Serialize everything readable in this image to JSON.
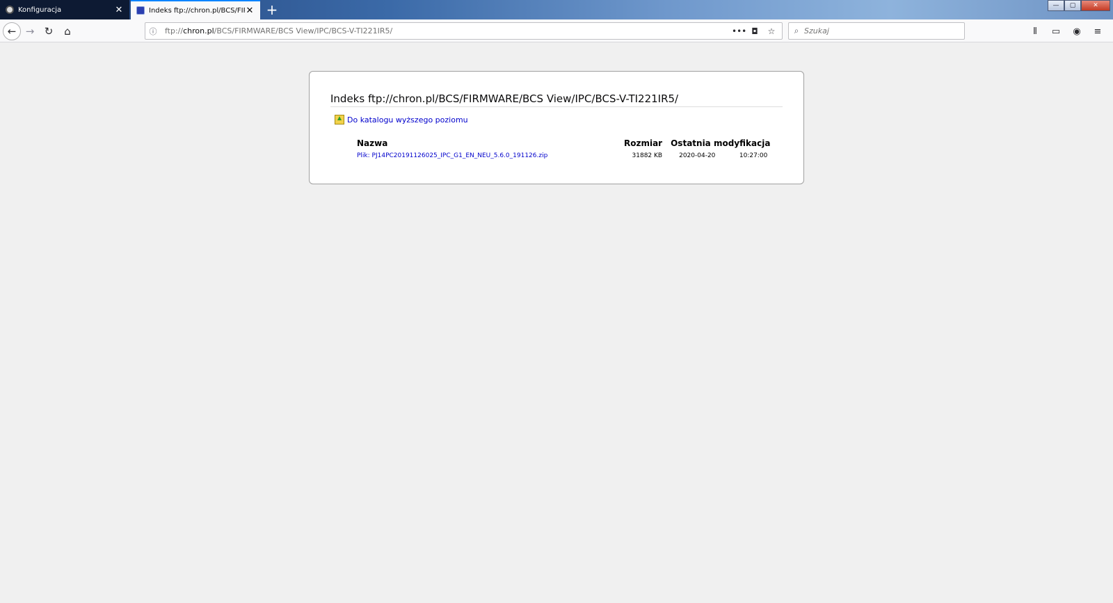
{
  "tabs": [
    {
      "title": "Konfiguracja",
      "close": "✕"
    },
    {
      "title": "Indeks ftp://chron.pl/BCS/FIRMWARE",
      "close": "✕"
    }
  ],
  "newtab_label": "+",
  "window_controls": {
    "minimize": "—",
    "maximize": "▢",
    "close": "✕"
  },
  "nav": {
    "back": "←",
    "forward": "→",
    "reload": "↻",
    "home": "⌂"
  },
  "urlbar": {
    "info_icon": "ⓘ",
    "scheme": "ftp://",
    "host": "chron.pl",
    "path": "/BCS/FIRMWARE/BCS View/IPC/BCS-V-TI221IR5/",
    "actions": {
      "more": "•••",
      "pocket": "◘",
      "bookmark": "☆"
    }
  },
  "search": {
    "icon": "⌕",
    "placeholder": "Szukaj"
  },
  "toolbar_icons": {
    "library": "⫴",
    "sidebar": "▭",
    "account": "◉",
    "menu": "≡"
  },
  "page": {
    "heading": "Indeks ftp://chron.pl/BCS/FIRMWARE/BCS View/IPC/BCS-V-TI221IR5/",
    "up_link": "Do katalogu wyższego poziomu",
    "columns": {
      "name": "Nazwa",
      "size": "Rozmiar",
      "modified": "Ostatnia modyfikacja"
    },
    "files": [
      {
        "name": "Plik: PJ14PC20191126025_IPC_G1_EN_NEU_5.6.0_191126.zip",
        "size": "31882 KB",
        "date": "2020-04-20",
        "time": "10:27:00"
      }
    ]
  }
}
